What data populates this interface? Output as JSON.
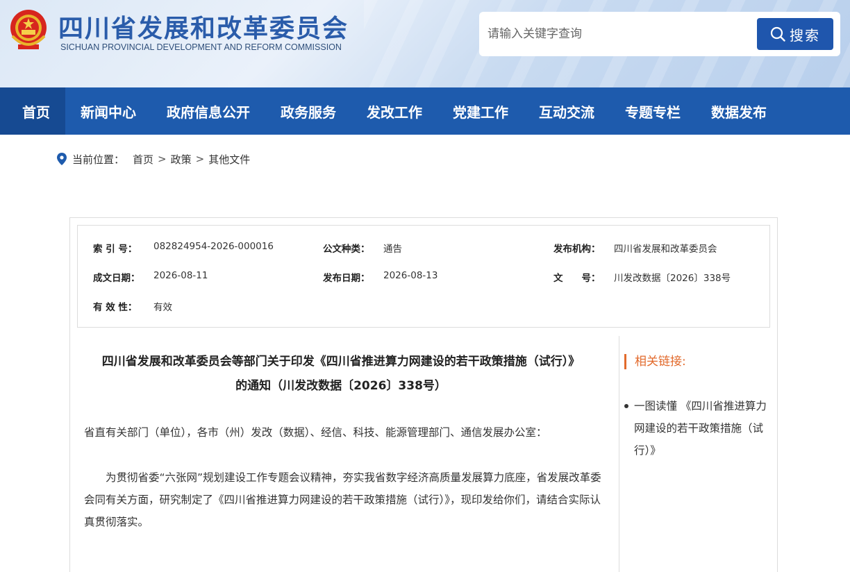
{
  "header": {
    "site_name": "四川省发展和改革委员会",
    "site_name_en": "SICHUAN PROVINCIAL DEVELOPMENT AND REFORM COMMISSION",
    "emblem_icon": "national-emblem-icon",
    "search": {
      "placeholder": "请输入关键字查询",
      "button_label": "搜索"
    }
  },
  "nav": {
    "items": [
      {
        "label": "首页",
        "active": true
      },
      {
        "label": "新闻中心"
      },
      {
        "label": "政府信息公开"
      },
      {
        "label": "政务服务"
      },
      {
        "label": "发改工作"
      },
      {
        "label": "党建工作"
      },
      {
        "label": "互动交流"
      },
      {
        "label": "专题专栏"
      },
      {
        "label": "数据发布"
      }
    ]
  },
  "breadcrumb": {
    "prefix": "当前位置：",
    "items": [
      "首页",
      "政策",
      "其他文件"
    ],
    "separator": ">"
  },
  "meta": {
    "index_no_label": "索 引 号：",
    "index_no": "082824954-2026-000016",
    "doc_type_label": "公文种类：",
    "doc_type": "通告",
    "publisher_label": "发布机构：",
    "publisher": "四川省发展和改革委员会",
    "written_date_label": "成文日期：",
    "written_date": "2026-08-11",
    "publish_date_label": "发布日期：",
    "publish_date": "2026-08-13",
    "doc_no_label": "文　　号：",
    "doc_no": "川发改数据〔2026〕338号",
    "validity_label": "有 效 性：",
    "validity": "有效"
  },
  "article": {
    "title_line1": "四川省发展和改革委员会等部门关于印发《四川省推进算力网建设的若干政策措施（试行）》",
    "title_line2": "的通知（川发改数据〔2026〕338号）",
    "salutation": "省直有关部门（单位），各市（州）发改（数据）、经信、科技、能源管理部门、通信发展办公室：",
    "para1": "为贯彻省委“六张网”规划建设工作专题会议精神，夯实我省数字经济高质量发展算力底座，省发展改革委会同有关方面，研究制定了《四川省推进算力网建设的若干政策措施（试行）》，现印发给你们，请结合实际认真贯彻落实。"
  },
  "related": {
    "title": "相关链接:",
    "links": [
      "一图读懂 《四川省推进算力网建设的若干政策措施（试行）》"
    ]
  },
  "colors": {
    "brand_blue": "#1e5bad",
    "accent_orange": "#e26a2c"
  }
}
